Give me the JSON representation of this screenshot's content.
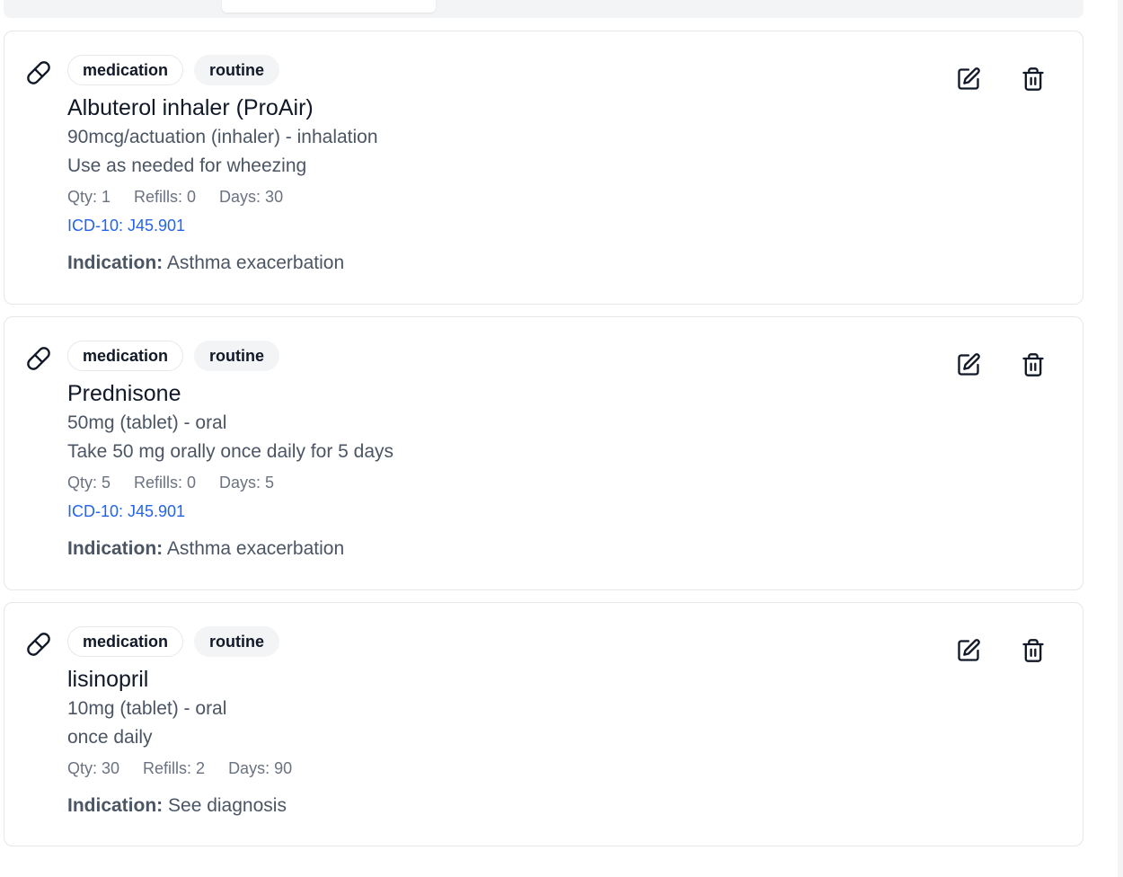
{
  "medications": [
    {
      "type_badge": "medication",
      "priority_badge": "routine",
      "name": "Albuterol inhaler (ProAir)",
      "dose_route": "90mcg/actuation (inhaler) - inhalation",
      "sig": "Use as needed for wheezing",
      "qty": "Qty: 1",
      "refills": "Refills: 0",
      "days": "Days: 30",
      "icd": "ICD-10: J45.901",
      "indication_label": "Indication:",
      "indication_value": "Asthma exacerbation"
    },
    {
      "type_badge": "medication",
      "priority_badge": "routine",
      "name": "Prednisone",
      "dose_route": "50mg (tablet) - oral",
      "sig": "Take 50 mg orally once daily for 5 days",
      "qty": "Qty: 5",
      "refills": "Refills: 0",
      "days": "Days: 5",
      "icd": "ICD-10: J45.901",
      "indication_label": "Indication:",
      "indication_value": "Asthma exacerbation"
    },
    {
      "type_badge": "medication",
      "priority_badge": "routine",
      "name": "lisinopril",
      "dose_route": "10mg (tablet) - oral",
      "sig": "once daily",
      "qty": "Qty: 30",
      "refills": "Refills: 2",
      "days": "Days: 90",
      "indication_label": "Indication:",
      "indication_value": "See diagnosis"
    }
  ],
  "icons": {
    "item_icon": "pill-icon",
    "edit": "edit-icon",
    "delete": "trash-icon"
  },
  "colors": {
    "icd_link": "#2563eb",
    "muted_text": "#6b7280",
    "body_text": "#4b5563",
    "border": "#e5e7eb"
  }
}
